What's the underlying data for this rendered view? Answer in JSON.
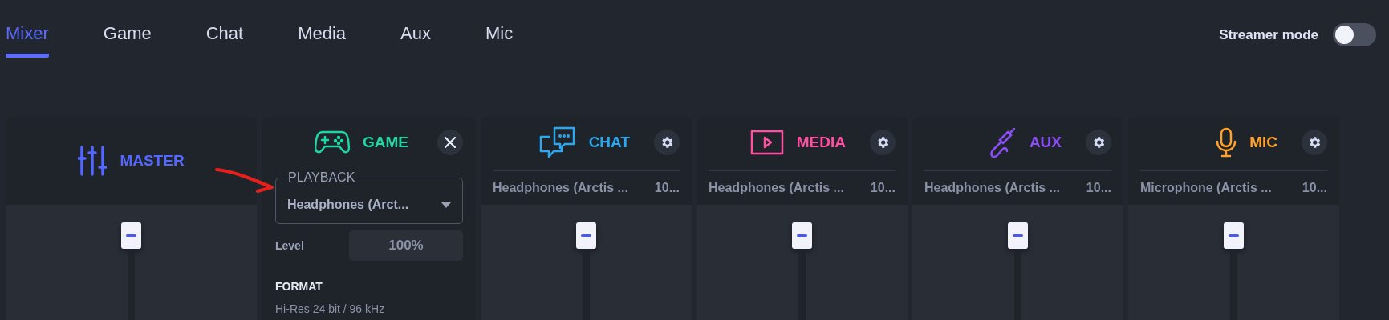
{
  "tabs": [
    {
      "label": "Mixer",
      "selected": true
    },
    {
      "label": "Game",
      "selected": false
    },
    {
      "label": "Chat",
      "selected": false
    },
    {
      "label": "Media",
      "selected": false
    },
    {
      "label": "Aux",
      "selected": false
    },
    {
      "label": "Mic",
      "selected": false
    }
  ],
  "streamer_mode": {
    "label": "Streamer mode",
    "on": false
  },
  "channels": [
    {
      "kind": "master",
      "name": "MASTER",
      "color": "#5468ff"
    },
    {
      "kind": "game",
      "name": "GAME",
      "color": "#1ed8a4",
      "playback": {
        "label": "PLAYBACK",
        "value": "Headphones (Arct..."
      },
      "level_label": "Level",
      "level_value": "100%",
      "format": {
        "heading": "FORMAT",
        "value": "Hi-Res 24 bit / 96 kHz"
      }
    },
    {
      "kind": "chat",
      "name": "CHAT",
      "color": "#2aa8f0",
      "device": "Headphones (Arctis ...",
      "volume": "10..."
    },
    {
      "kind": "media",
      "name": "MEDIA",
      "color": "#ff4fa3",
      "device": "Headphones (Arctis ...",
      "volume": "10..."
    },
    {
      "kind": "aux",
      "name": "AUX",
      "color": "#8b4df5",
      "device": "Headphones (Arctis ...",
      "volume": "10..."
    },
    {
      "kind": "mic",
      "name": "MIC",
      "color": "#ffa12a",
      "device": "Microphone (Arctis ...",
      "volume": "10..."
    }
  ]
}
